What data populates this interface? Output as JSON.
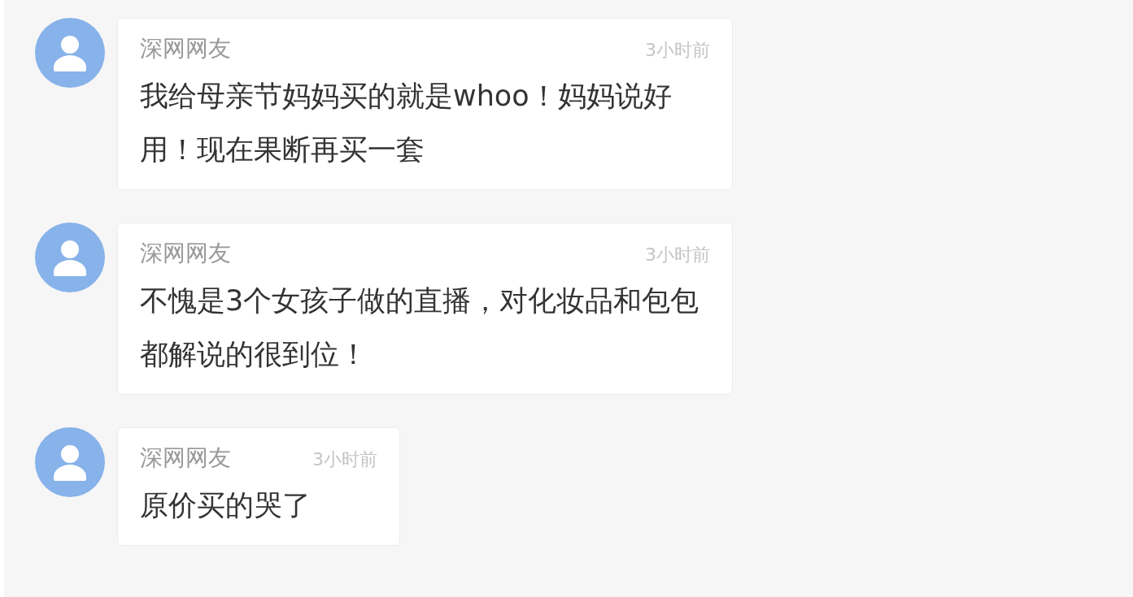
{
  "comments": [
    {
      "author": "深网网友",
      "time": "3小时前",
      "text": "我给母亲节妈妈买的就是whoo！妈妈说好用！现在果断再买一套"
    },
    {
      "author": "深网网友",
      "time": "3小时前",
      "text": "不愧是3个女孩子做的直播，对化妆品和包包都解说的很到位！"
    },
    {
      "author": "深网网友",
      "time": "3小时前",
      "text": "原价买的哭了"
    }
  ]
}
